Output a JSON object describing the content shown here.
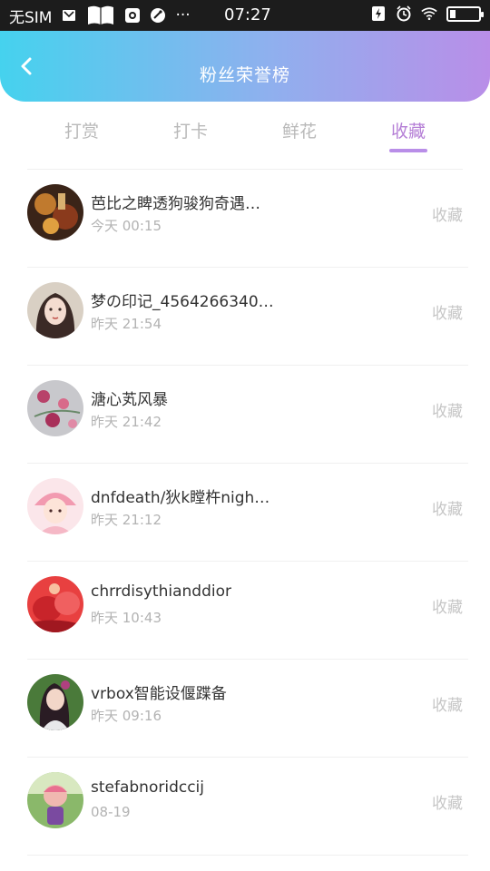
{
  "status_bar": {
    "carrier": "无SIM",
    "time": "07:27",
    "ellipsis": "···",
    "icons": [
      "message-icon",
      "book-icon",
      "sim-icon",
      "tool-icon",
      "lightning-icon",
      "alarm-icon",
      "wifi-icon",
      "battery-icon"
    ]
  },
  "header": {
    "title": "粉丝荣誉榜",
    "back_icon": "back-arrow-icon"
  },
  "tabs": [
    {
      "label": "打赏",
      "active": false
    },
    {
      "label": "打卡",
      "active": false
    },
    {
      "label": "鲜花",
      "active": false
    },
    {
      "label": "收藏",
      "active": true
    }
  ],
  "colors": {
    "header_gradient_start": "#45d2ee",
    "header_gradient_end": "#b98ee8",
    "active_tab": "#b57fd6",
    "inactive_tab": "#b9b9b9"
  },
  "list": [
    {
      "name": "芭比之睥透狗骏狗奇遇…",
      "time": "今天 00:15",
      "action": "收藏"
    },
    {
      "name": "梦の印记_4564266340…",
      "time": "昨天 21:54",
      "action": "收藏"
    },
    {
      "name": "溏心芄风暴",
      "time": "昨天 21:42",
      "action": "收藏"
    },
    {
      "name": "dnfdeath/狄k瞠杵nigh…",
      "time": "昨天 21:12",
      "action": "收藏"
    },
    {
      "name": "chrrdisythianddior",
      "time": "昨天 10:43",
      "action": "收藏"
    },
    {
      "name": "vrbox智能设偃蹀备",
      "time": "昨天 09:16",
      "action": "收藏"
    },
    {
      "name": "stefabnoridccij",
      "time": "08-19",
      "action": "收藏"
    }
  ]
}
